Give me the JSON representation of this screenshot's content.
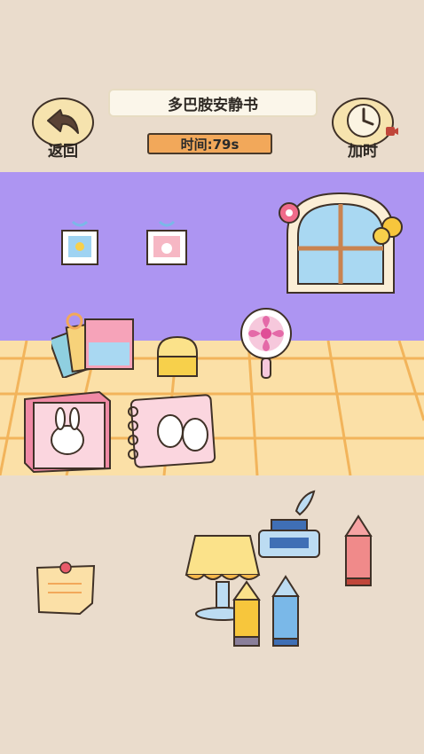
{
  "header": {
    "back_label": "返回",
    "title": "多巴胺安静书",
    "timer_label": "时间:79s",
    "add_time_label": "加时"
  },
  "icons": {
    "back": "arrow-back-icon",
    "add_time": "clock-icon",
    "ad": "video-ad-icon"
  },
  "scene": {
    "room_items": [
      "photo-frame-flower",
      "photo-frame-bunny",
      "window",
      "color-swatch-cards",
      "yellow-bag",
      "desk-fan",
      "bunny-box",
      "bunny-notebook"
    ],
    "tray_items": [
      "sticky-note",
      "table-lamp",
      "ink-bottle-with-quill",
      "pink-pencil",
      "yellow-pencil",
      "blue-pencil"
    ]
  },
  "colors": {
    "background": "#eadccc",
    "wall": "#ad95f2",
    "floor": "#fbe0a7",
    "timer": "#f2a85a",
    "outline": "#3f3127"
  }
}
